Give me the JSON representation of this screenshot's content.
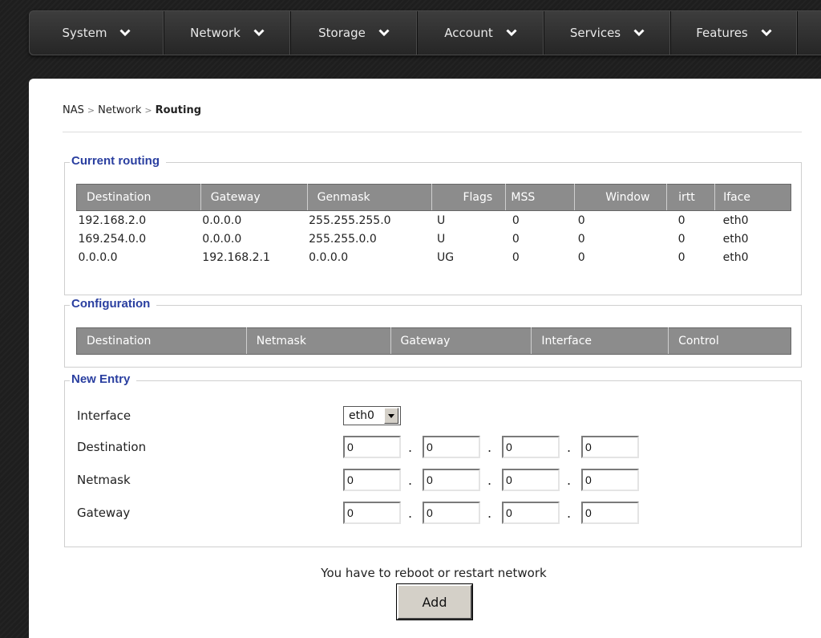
{
  "nav": {
    "items": [
      {
        "label": "System",
        "name": "nav-system"
      },
      {
        "label": "Network",
        "name": "nav-network"
      },
      {
        "label": "Storage",
        "name": "nav-storage"
      },
      {
        "label": "Account",
        "name": "nav-account"
      },
      {
        "label": "Services",
        "name": "nav-services"
      },
      {
        "label": "Features",
        "name": "nav-features"
      }
    ],
    "chevron_icon": "chevron-down-icon"
  },
  "breadcrumb": {
    "root": "NAS",
    "parent": "Network",
    "current": "Routing",
    "separator": ">"
  },
  "current_routing": {
    "legend": "Current routing",
    "headers": [
      "Destination",
      "Gateway",
      "Genmask",
      "Flags",
      "MSS",
      "Window",
      "irtt",
      "Iface"
    ],
    "rows": [
      [
        "192.168.2.0",
        "0.0.0.0",
        "255.255.255.0",
        "U",
        "0",
        "0",
        "0",
        "eth0"
      ],
      [
        "169.254.0.0",
        "0.0.0.0",
        "255.255.0.0",
        "U",
        "0",
        "0",
        "0",
        "eth0"
      ],
      [
        "0.0.0.0",
        "192.168.2.1",
        "0.0.0.0",
        "UG",
        "0",
        "0",
        "0",
        "eth0"
      ]
    ]
  },
  "configuration": {
    "legend": "Configuration",
    "headers": [
      "Destination",
      "Netmask",
      "Gateway",
      "Interface",
      "Control"
    ]
  },
  "new_entry": {
    "legend": "New Entry",
    "interface_label": "Interface",
    "interface_value": "eth0",
    "destination_label": "Destination",
    "netmask_label": "Netmask",
    "gateway_label": "Gateway",
    "destination": [
      "0",
      "0",
      "0",
      "0"
    ],
    "netmask": [
      "0",
      "0",
      "0",
      "0"
    ],
    "gateway": [
      "0",
      "0",
      "0",
      "0"
    ],
    "dot": "."
  },
  "notice": "You have to reboot or restart network",
  "add_button": "Add",
  "colors": {
    "legend": "#2a3fa0",
    "table_header": "#8c8c8c",
    "nav_bg": "#2e2e2e"
  }
}
